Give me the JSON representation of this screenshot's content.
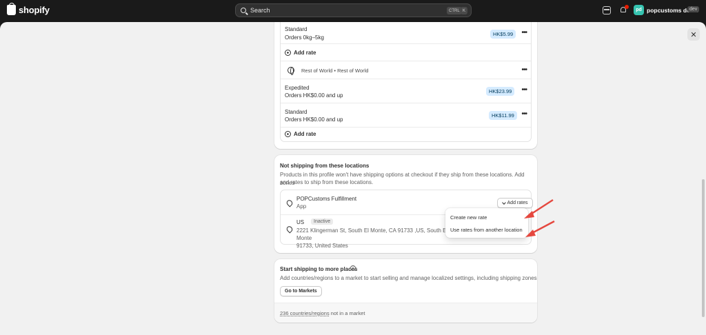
{
  "topbar": {
    "brand": "shopify",
    "search_placeholder": "Search",
    "shortcut_ctrl": "CTRL",
    "shortcut_key": "K",
    "avatar_initials": "pd",
    "store_name": "popcustoms demo",
    "store_badge": "dev"
  },
  "zone_card": {
    "rates_top": [
      {
        "name": "Standard",
        "condition": "Orders 0kg–5kg",
        "price": "HK$5.99"
      }
    ],
    "add_rate_label": "Add rate",
    "rest_of_world_label": "Rest of World • Rest of World",
    "rates_bottom": [
      {
        "name": "Expedited",
        "condition": "Orders HK$0.00 and up",
        "price": "HK$23.99"
      },
      {
        "name": "Standard",
        "condition": "Orders HK$0.00 and up",
        "price": "HK$11.99"
      }
    ]
  },
  "not_shipping": {
    "title": "Not shipping from these locations",
    "description_line1": "Products in this profile won't have shipping options at checkout if they ship from these locations. Add zones",
    "description_line2": "and rates to ship from these locations.",
    "locations": [
      {
        "name": "POPCustoms Fulfillment",
        "sub": "App"
      },
      {
        "name": "US",
        "badge": "Inactive",
        "address_line1": "2221 Klingerman St, South El Monte, CA 91733 ,US, South El Monte",
        "address_line2": "91733, United States"
      }
    ],
    "add_rates_button": "Add rates",
    "menu": [
      "Create new rate",
      "Use rates from another location"
    ]
  },
  "more_places": {
    "title": "Start shipping to more places",
    "info_icon": "i",
    "description": "Add countries/regions to a market to start selling and manage localized settings, including shipping zones",
    "button": "Go to Markets",
    "footer_link": "236 countries/regions",
    "footer_rest": " not in a market"
  },
  "close_icon": "✕",
  "colors": {
    "accent_arrow": "#e5483f",
    "price_badge_bg": "#d5ebff"
  }
}
